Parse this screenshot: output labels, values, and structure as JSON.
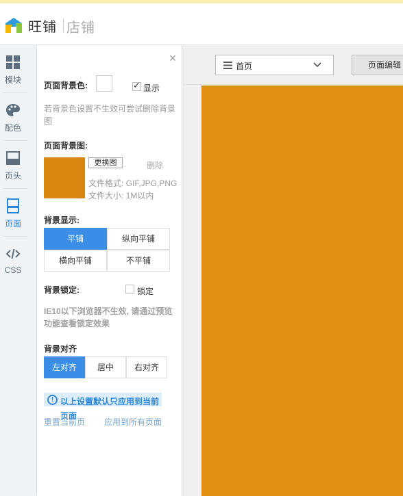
{
  "colors": {
    "accent": "#3a8ee6",
    "canvas_bg": "#df9211",
    "top_strip": "#fbeeb2"
  },
  "header": {
    "logo_icon": "house-logo-icon",
    "logo_text": "旺铺",
    "logo_sub": "店铺"
  },
  "left_nav": {
    "items": [
      {
        "label": "模块",
        "icon": "grid-icon",
        "active": false
      },
      {
        "label": "配色",
        "icon": "palette-icon",
        "active": false
      },
      {
        "label": "页头",
        "icon": "header-icon",
        "active": false
      },
      {
        "label": "页面",
        "icon": "page-icon",
        "active": true
      },
      {
        "label": "CSS",
        "icon": "code-icon",
        "active": false
      }
    ]
  },
  "panel": {
    "close_icon": "close-icon",
    "bg_color_label": "页面背景色:",
    "show_label": "显示",
    "show_checked": true,
    "bg_color_hint": "若背景色设置不生效可尝试删除背景图",
    "bg_image_label": "页面背景图:",
    "replace_button": "更换图",
    "delete_link": "删除",
    "file_format": "文件格式: GIF,JPG,PNG",
    "file_size": "文件大小: 1M以内",
    "bg_display_label": "背景显示:",
    "display_options": [
      "平铺",
      "纵向平铺",
      "横向平铺",
      "不平铺"
    ],
    "display_selected": "平铺",
    "bg_lock_label": "背景锁定:",
    "lock_label": "锁定",
    "lock_checked": false,
    "lock_hint": "IE10以下浏览器不生效, 请通过预览功能查看锁定效果",
    "align_label": "背景对齐",
    "align_options": [
      "左对齐",
      "居中",
      "右对齐"
    ],
    "align_selected": "左对齐",
    "note_text_1": "以上设置默认只应用到当前",
    "note_text_2": "页面",
    "reset_link": "重置当前页",
    "apply_all_link": "应用到所有页面"
  },
  "toolbar": {
    "page_select_value": "首页",
    "edit_button": "页面编辑"
  }
}
